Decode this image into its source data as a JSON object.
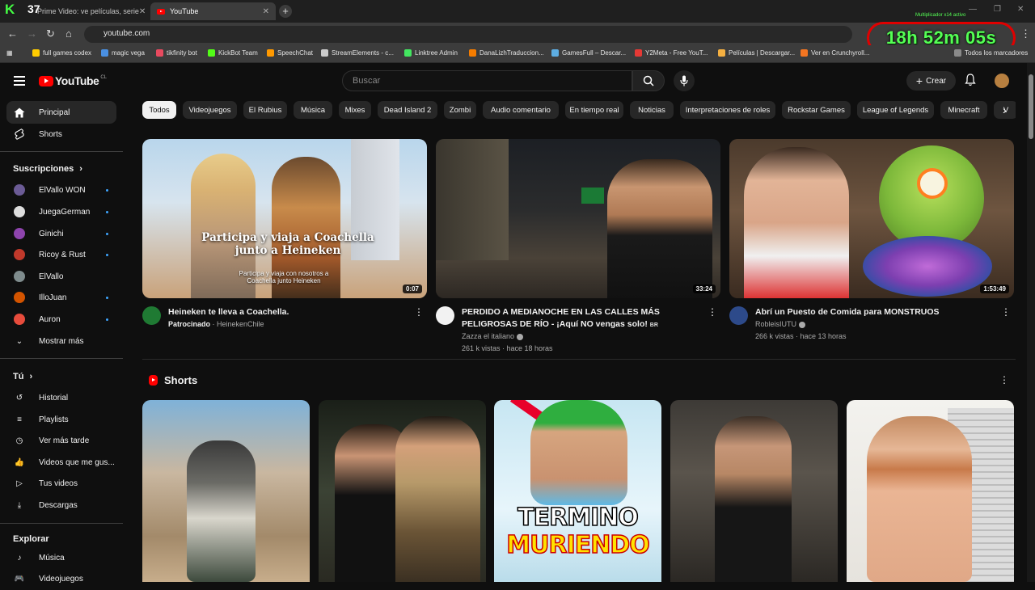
{
  "browser": {
    "k_badge": "37",
    "tabs": [
      {
        "label": "Prime Video: ve películas, serie"
      },
      {
        "label": "YouTube"
      }
    ],
    "url": "youtube.com",
    "timer": "18h 52m 05s",
    "multiplier": "Multiplicador x14 activo",
    "bookmarks": [
      {
        "label": "full games codex",
        "color": "#ffcc00"
      },
      {
        "label": "magic vega",
        "color": "#4a90e2"
      },
      {
        "label": "tikfinity bot",
        "color": "#e84a5f"
      },
      {
        "label": "KickBot Team",
        "color": "#53fc18"
      },
      {
        "label": "SpeechChat",
        "color": "#ff9900"
      },
      {
        "label": "StreamElements - c...",
        "color": "#cccccc"
      },
      {
        "label": "Linktree Admin",
        "color": "#43e660"
      },
      {
        "label": "DanaLizhTraduccion...",
        "color": "#f57c00"
      },
      {
        "label": "GamesFull – Descar...",
        "color": "#5dade2"
      },
      {
        "label": "Y2Meta - Free YouT...",
        "color": "#e53935"
      },
      {
        "label": "Películas | Descargar...",
        "color": "#f5b041"
      },
      {
        "label": "Ver en Crunchyroll...",
        "color": "#f47521"
      },
      {
        "label": "Todos los marcadores",
        "color": "#8a8a8a"
      }
    ]
  },
  "header": {
    "logo": "YouTube",
    "country": "CL",
    "search_placeholder": "Buscar",
    "create_label": "Crear"
  },
  "sidebar": {
    "main": [
      {
        "label": "Principal",
        "icon": "home-icon"
      },
      {
        "label": "Shorts",
        "icon": "shorts-icon"
      }
    ],
    "subs_title": "Suscripciones",
    "subscriptions": [
      {
        "label": "ElVallo WON",
        "color": "#6b5b95"
      },
      {
        "label": "JuegaGerman",
        "color": "#dddddd"
      },
      {
        "label": "Ginichi",
        "color": "#8e44ad"
      },
      {
        "label": "Ricoy & Rust",
        "color": "#c0392b"
      },
      {
        "label": "ElVallo",
        "color": "#7f8c8d"
      },
      {
        "label": "IlloJuan",
        "color": "#d35400"
      },
      {
        "label": "Auron",
        "color": "#e74c3c"
      }
    ],
    "show_more": "Mostrar más",
    "you_title": "Tú",
    "you_items": [
      {
        "label": "Historial",
        "icon": "history-icon"
      },
      {
        "label": "Playlists",
        "icon": "playlists-icon"
      },
      {
        "label": "Ver más tarde",
        "icon": "watch-later-icon"
      },
      {
        "label": "Videos que me gus...",
        "icon": "like-icon"
      },
      {
        "label": "Tus videos",
        "icon": "your-videos-icon"
      },
      {
        "label": "Descargas",
        "icon": "download-icon"
      }
    ],
    "explore_title": "Explorar",
    "explore_items": [
      {
        "label": "Música",
        "icon": "music-icon"
      },
      {
        "label": "Videojuegos",
        "icon": "gaming-icon"
      }
    ]
  },
  "chips": [
    "Todos",
    "Videojuegos",
    "El Rubius",
    "Música",
    "Mixes",
    "Dead Island 2",
    "Zombi",
    "Audio comentario",
    "En tiempo real",
    "Noticias",
    "Interpretaciones de roles",
    "Rockstar Games",
    "League of Legends",
    "Minecraft",
    "V"
  ],
  "videos": [
    {
      "title": "Heineken te lleva a Coachella.",
      "sponsor": "Patrocinado",
      "channel": "HeinekenChile",
      "duration": "0:07",
      "thumb_text": "Participa y viaja a Coachella junto a Heineken",
      "thumb_sub": "Participa y viaja con nosotros a Coachella junto Heineken"
    },
    {
      "title": "PERDIDO A MEDIANOCHE EN LAS CALLES MÁS PELIGROSAS DE RÍO - ¡Aquí NO vengas solo!",
      "badge": "BR",
      "channel": "Zazza el italiano",
      "stats": "261 k vistas · hace 18 horas",
      "duration": "33:24"
    },
    {
      "title": "Abrí un Puesto de Comida para MONSTRUOS",
      "channel": "RobleisIUTU",
      "stats": "266 k vistas · hace 13 horas",
      "duration": "1:53:49"
    }
  ],
  "shorts": {
    "title": "Shorts",
    "overlay_line1": "TERMINO",
    "overlay_line2": "MURIENDO"
  }
}
